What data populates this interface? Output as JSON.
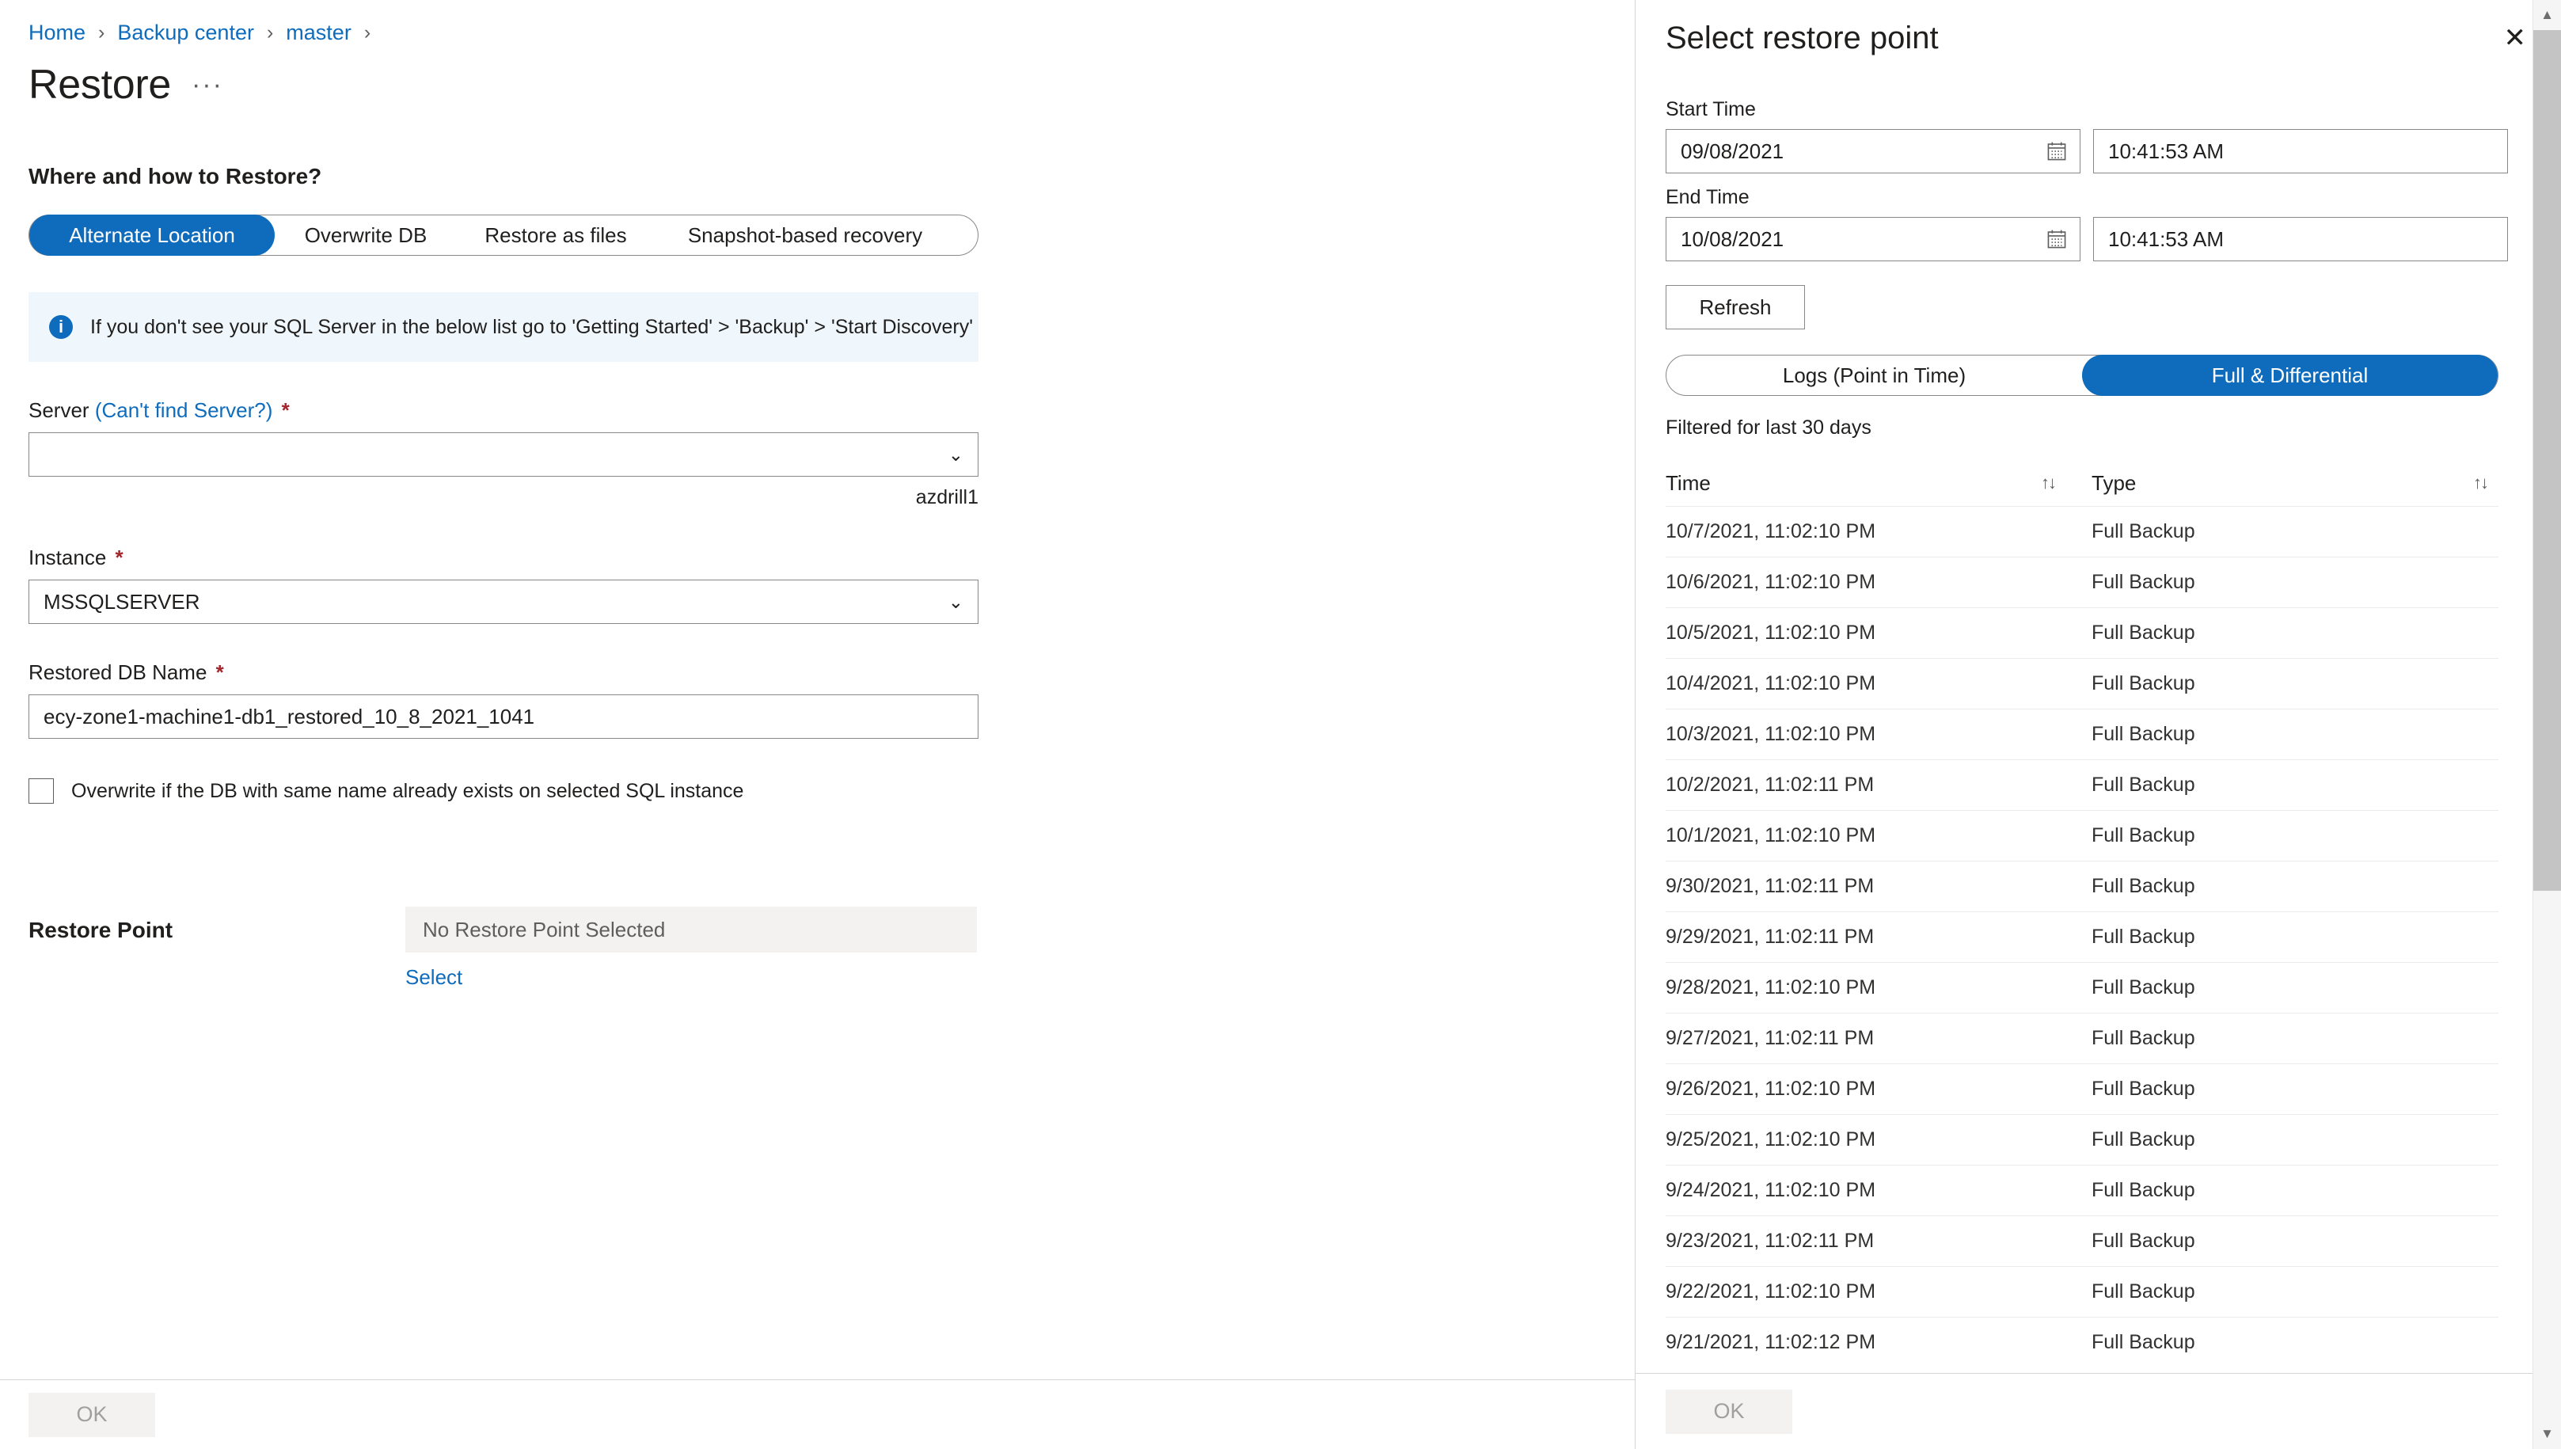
{
  "breadcrumb": {
    "items": [
      "Home",
      "Backup center",
      "master"
    ],
    "separator": "›"
  },
  "header": {
    "title": "Restore",
    "ellipsis": "···"
  },
  "left": {
    "section_heading": "Where and how to Restore?",
    "tabs": [
      {
        "label": "Alternate Location",
        "selected": true
      },
      {
        "label": "Overwrite DB",
        "selected": false
      },
      {
        "label": "Restore as files",
        "selected": false
      },
      {
        "label": "Snapshot-based recovery",
        "selected": false
      }
    ],
    "info_banner": {
      "icon": "info-icon",
      "glyph": "i",
      "text": "If you don't see your SQL Server in the below list go to 'Getting Started' > 'Backup' > 'Start Discovery'"
    },
    "server_field": {
      "label": "Server",
      "link": "(Can't find Server?)",
      "required": "*",
      "value": "",
      "hint": "azdrill1",
      "chevron": "⌄"
    },
    "instance_field": {
      "label": "Instance",
      "required": "*",
      "value": "MSSQLSERVER",
      "chevron": "⌄"
    },
    "db_name_field": {
      "label": "Restored DB Name",
      "required": "*",
      "value": "ecy-zone1-machine1-db1_restored_10_8_2021_1041"
    },
    "overwrite_checkbox": {
      "label": "Overwrite if the DB with same name already exists on selected SQL instance",
      "checked": false
    },
    "restore_point": {
      "label": "Restore Point",
      "value": "No Restore Point Selected",
      "select_link": "Select"
    },
    "ok_label": "OK"
  },
  "panel": {
    "title": "Select restore point",
    "close_icon": "✕",
    "start_time": {
      "label": "Start Time",
      "date": "09/08/2021",
      "time": "10:41:53 AM"
    },
    "end_time": {
      "label": "End Time",
      "date": "10/08/2021",
      "time": "10:41:53 AM"
    },
    "refresh_label": "Refresh",
    "segments": [
      {
        "label": "Logs (Point in Time)",
        "selected": false
      },
      {
        "label": "Full & Differential",
        "selected": true
      }
    ],
    "filtered_note": "Filtered for last 30 days",
    "table": {
      "columns": [
        {
          "label": "Time",
          "sort_icon": "↑↓"
        },
        {
          "label": "Type",
          "sort_icon": "↑↓"
        }
      ],
      "rows": [
        {
          "time": "10/7/2021, 11:02:10 PM",
          "type": "Full Backup"
        },
        {
          "time": "10/6/2021, 11:02:10 PM",
          "type": "Full Backup"
        },
        {
          "time": "10/5/2021, 11:02:10 PM",
          "type": "Full Backup"
        },
        {
          "time": "10/4/2021, 11:02:10 PM",
          "type": "Full Backup"
        },
        {
          "time": "10/3/2021, 11:02:10 PM",
          "type": "Full Backup"
        },
        {
          "time": "10/2/2021, 11:02:11 PM",
          "type": "Full Backup"
        },
        {
          "time": "10/1/2021, 11:02:10 PM",
          "type": "Full Backup"
        },
        {
          "time": "9/30/2021, 11:02:11 PM",
          "type": "Full Backup"
        },
        {
          "time": "9/29/2021, 11:02:11 PM",
          "type": "Full Backup"
        },
        {
          "time": "9/28/2021, 11:02:10 PM",
          "type": "Full Backup"
        },
        {
          "time": "9/27/2021, 11:02:11 PM",
          "type": "Full Backup"
        },
        {
          "time": "9/26/2021, 11:02:10 PM",
          "type": "Full Backup"
        },
        {
          "time": "9/25/2021, 11:02:10 PM",
          "type": "Full Backup"
        },
        {
          "time": "9/24/2021, 11:02:10 PM",
          "type": "Full Backup"
        },
        {
          "time": "9/23/2021, 11:02:11 PM",
          "type": "Full Backup"
        },
        {
          "time": "9/22/2021, 11:02:10 PM",
          "type": "Full Backup"
        },
        {
          "time": "9/21/2021, 11:02:12 PM",
          "type": "Full Backup"
        }
      ]
    },
    "ok_label": "OK"
  },
  "scrollbar": {
    "up": "▲",
    "down": "▼",
    "thumb_pct": 62
  },
  "colors": {
    "accent": "#0f6cbd",
    "link": "#0f6cbd",
    "required": "#a4262c",
    "info_bg": "#eff6fc",
    "disabled_btn": "#f3f2f1"
  }
}
